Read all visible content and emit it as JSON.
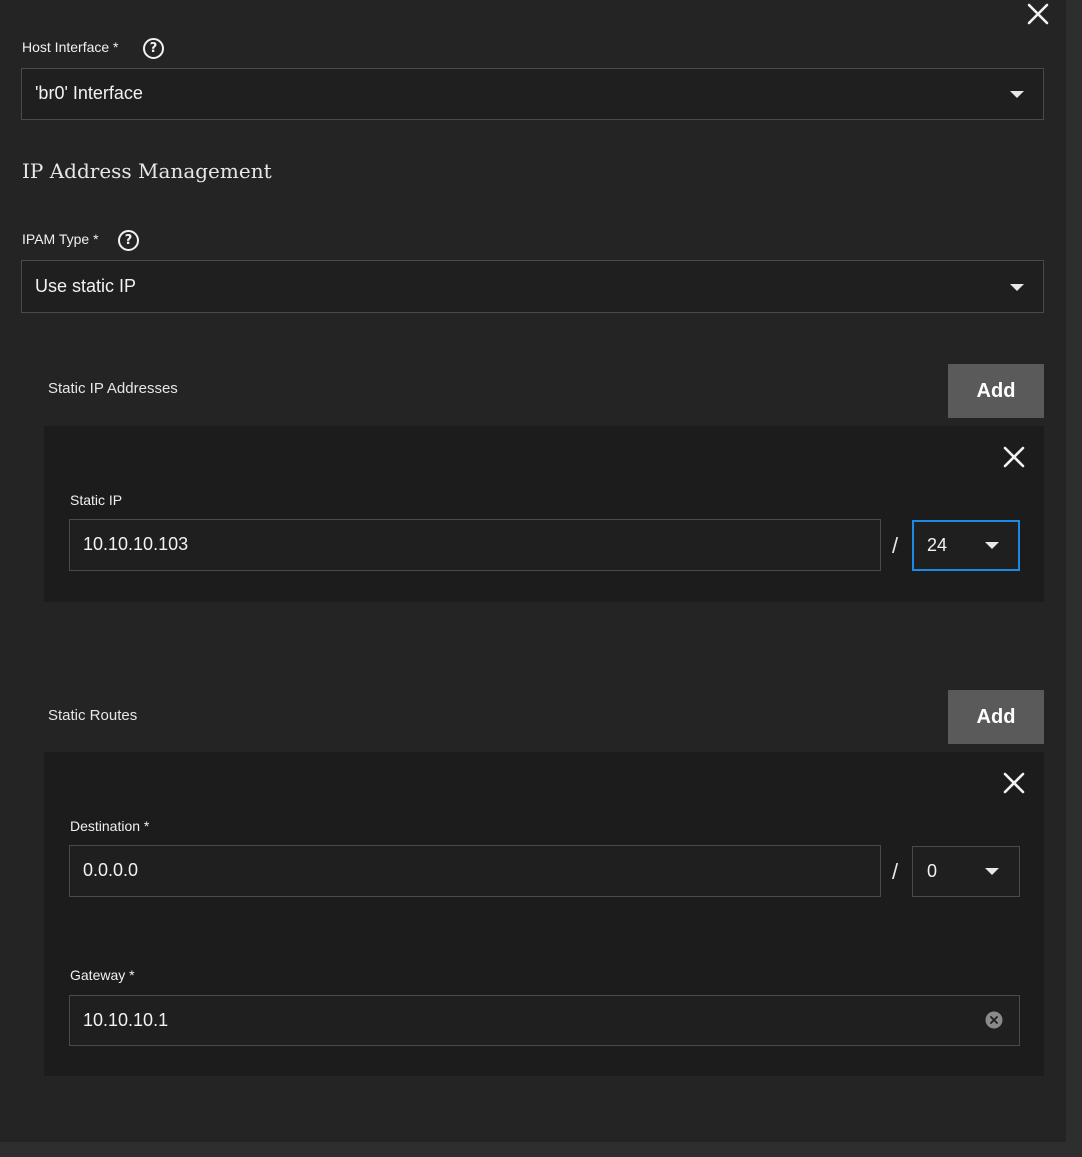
{
  "host_interface": {
    "label": "Host Interface *",
    "value": "'br0' Interface"
  },
  "ipam_section": {
    "title": "IP Address Management"
  },
  "ipam_type": {
    "label": "IPAM Type *",
    "value": "Use static IP"
  },
  "static_ips": {
    "header": "Static IP Addresses",
    "add_label": "Add",
    "item": {
      "label": "Static IP",
      "ip_value": "10.10.10.103",
      "separator": "/",
      "mask_value": "24"
    }
  },
  "static_routes": {
    "header": "Static Routes",
    "add_label": "Add",
    "item": {
      "destination_label": "Destination *",
      "destination_value": "0.0.0.0",
      "separator": "/",
      "mask_value": "0",
      "gateway_label": "Gateway *",
      "gateway_value": "10.10.10.1"
    }
  },
  "colors": {
    "panel_bg": "#242424",
    "field_bg": "#1f1f1f",
    "card_bg": "#1c1c1c",
    "add_button_bg": "#5a5a5a",
    "focus_border": "#1e88e5"
  },
  "icons": {
    "close": "close-icon",
    "help": "help-circle-icon",
    "dropdown": "chevron-down-icon",
    "clear": "clear-circle-icon"
  }
}
